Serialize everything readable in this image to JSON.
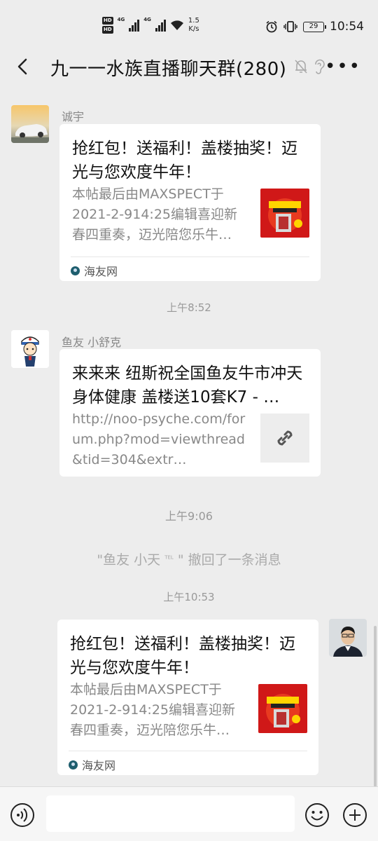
{
  "status_bar": {
    "network_speed_value": "1.5",
    "network_speed_unit": "K/s",
    "battery": "29",
    "time": "10:54"
  },
  "header": {
    "title": "九一一水族直播聊天群(280)"
  },
  "messages": [
    {
      "sender": "诚宇",
      "card_title": "抢红包！送福利！盖楼抽奖！迈光与您欢度牛年！",
      "card_desc": "本帖最后由MAXSPECT于2021-2-914:25编辑喜迎新春四重奏，迈光陪您乐牛…",
      "source": "海友网"
    },
    {
      "time": "上午8:52"
    },
    {
      "sender": "鱼友 小舒克",
      "card_title": "来来来 纽斯祝全国鱼友牛市冲天 身体健康 盖楼送10套K7 - …",
      "card_desc": "http://noo-psyche.com/forum.php?mod=viewthread&tid=304&extr…"
    },
    {
      "time": "上午9:06"
    },
    {
      "recall_prefix": "\"鱼友 小天",
      "recall_tag": "TEL",
      "recall_suffix": "\" 撤回了一条消息"
    },
    {
      "time": "上午10:53"
    },
    {
      "card_title": "抢红包！送福利！盖楼抽奖！迈光与您欢度牛年！",
      "card_desc": "本帖最后由MAXSPECT于2021-2-914:25编辑喜迎新春四重奏，迈光陪您乐牛…",
      "source": "海友网"
    }
  ],
  "colors": {
    "background": "#ededed",
    "card": "#ffffff",
    "muted_text": "#888888"
  }
}
